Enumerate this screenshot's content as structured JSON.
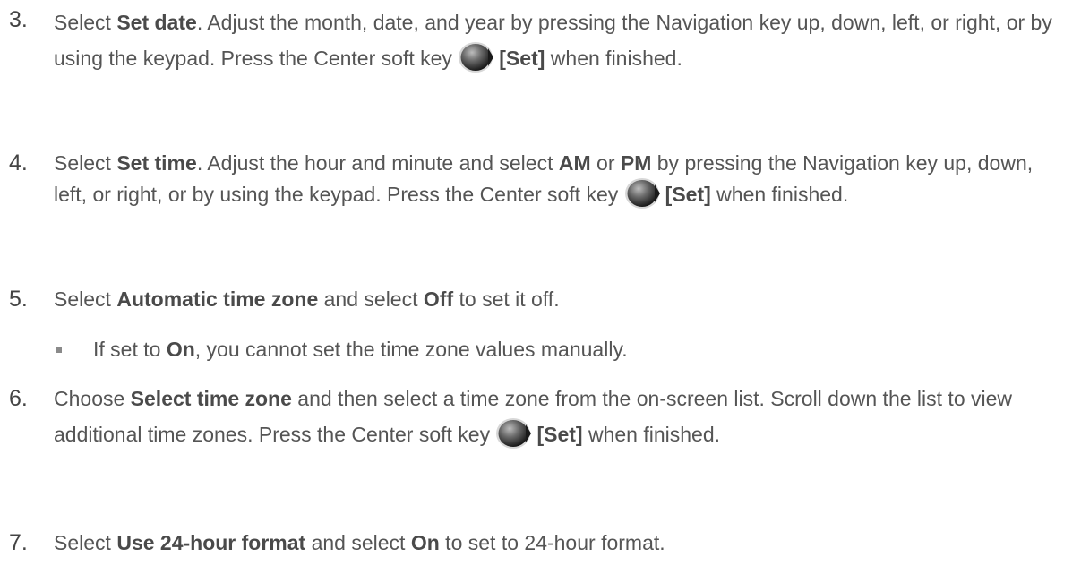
{
  "steps": [
    {
      "number": "3.",
      "segments": [
        {
          "t": "Select "
        },
        {
          "t": "Set date",
          "b": true
        },
        {
          "t": ". Adjust the month, date, and year by pressing the Navigation key up, down, left, or right, or by using the keypad. Press the Center soft key "
        },
        {
          "icon": "center-soft-key-icon"
        },
        {
          "t": "[Set]",
          "b": true
        },
        {
          "t": " when finished."
        }
      ]
    },
    {
      "number": "4.",
      "segments": [
        {
          "t": "Select "
        },
        {
          "t": "Set time",
          "b": true
        },
        {
          "t": ". Adjust the hour and minute and select "
        },
        {
          "t": "AM",
          "b": true
        },
        {
          "t": " or "
        },
        {
          "t": "PM",
          "b": true
        },
        {
          "t": " by pressing the Navigation key up, down, left, or right, or by using the keypad. Press the Center soft key "
        },
        {
          "icon": "center-soft-key-icon"
        },
        {
          "t": "[Set]",
          "b": true
        },
        {
          "t": " when finished."
        }
      ]
    },
    {
      "number": "5.",
      "segments": [
        {
          "t": "Select "
        },
        {
          "t": "Automatic time zone",
          "b": true
        },
        {
          "t": " and select "
        },
        {
          "t": "Off",
          "b": true
        },
        {
          "t": " to set it off."
        }
      ]
    },
    {
      "number": "6.",
      "segments": [
        {
          "t": "Choose "
        },
        {
          "t": "Select time zone",
          "b": true
        },
        {
          "t": " and then select a time zone from the on-screen list. Scroll down the list to view additional time zones. Press the Center soft key "
        },
        {
          "icon": "center-soft-key-icon"
        },
        {
          "t": "[Set]",
          "b": true
        },
        {
          "t": " when finished."
        }
      ]
    },
    {
      "number": "7.",
      "segments": [
        {
          "t": "Select "
        },
        {
          "t": "Use 24-hour format",
          "b": true
        },
        {
          "t": " and select "
        },
        {
          "t": "On",
          "b": true
        },
        {
          "t": " to set to 24-hour format."
        }
      ]
    }
  ],
  "bullet": {
    "segments": [
      {
        "t": "If set to "
      },
      {
        "t": "On",
        "b": true
      },
      {
        "t": ", you cannot set the time zone values manually."
      }
    ]
  }
}
